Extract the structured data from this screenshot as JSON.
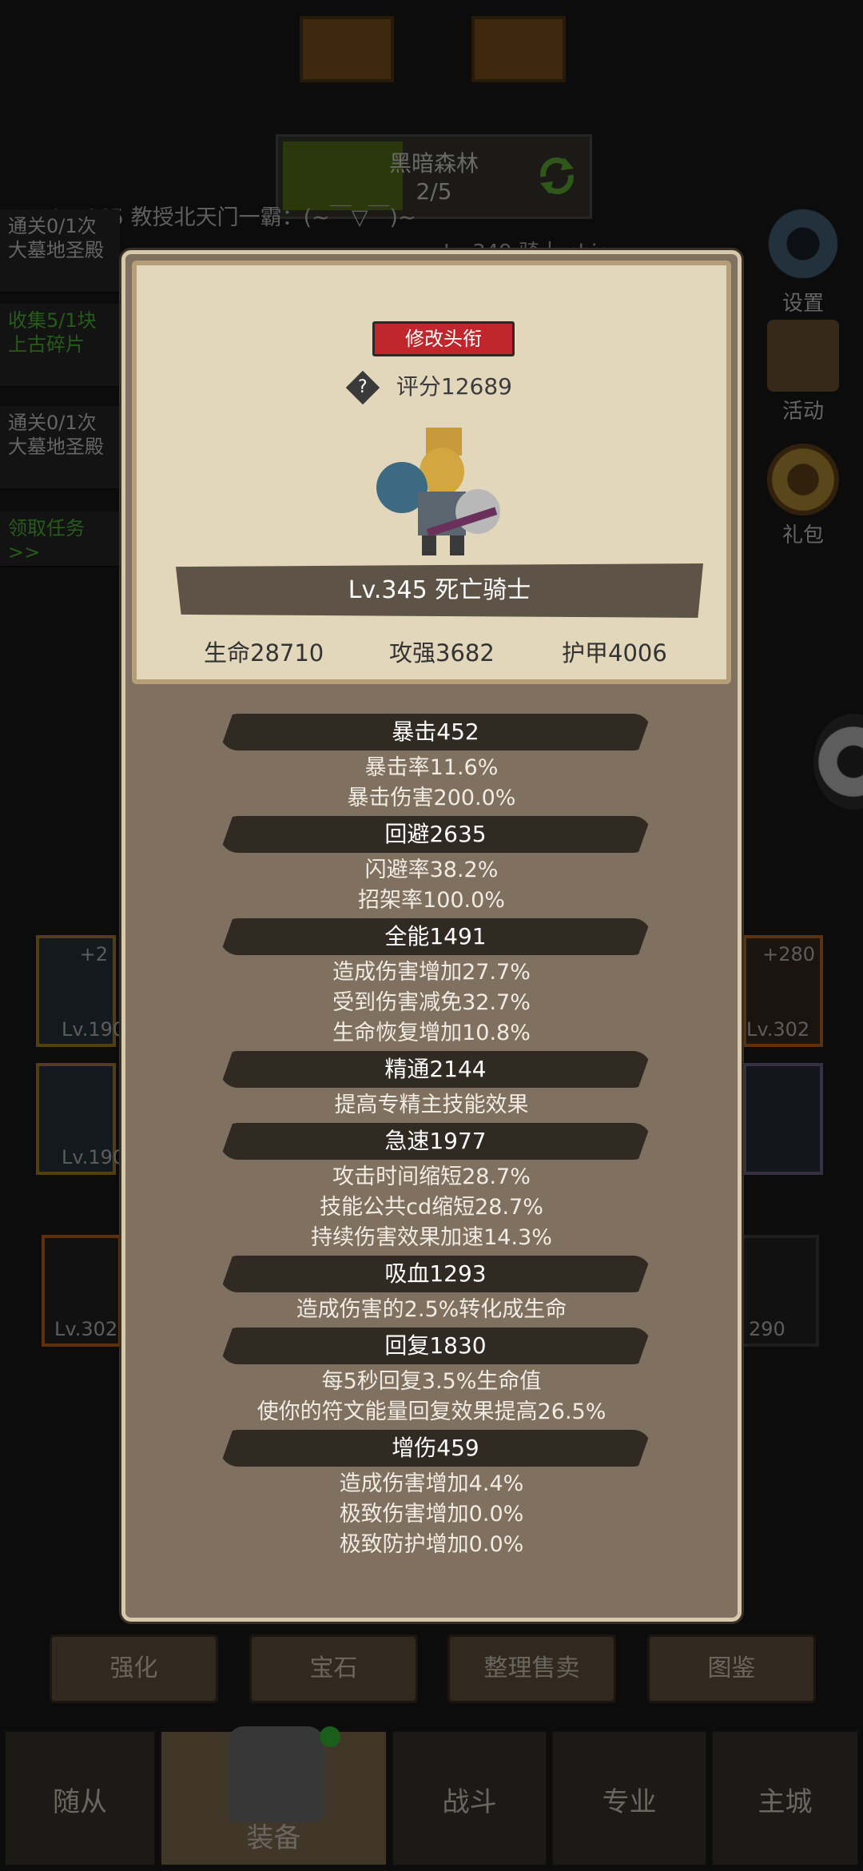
{
  "background": {
    "map": {
      "name": "黑暗森林",
      "progress": "2/5"
    },
    "player_line": "Lv.445 教授北天门一霸：(~￣▽￣)~",
    "other_player": "Lv.349 骑士 chic",
    "quests": [
      {
        "text": "通关0/1次大墓地圣殿",
        "color": "#dddddd"
      },
      {
        "text": "收集5/1块上古碎片",
        "color": "#55c93a"
      },
      {
        "text": "通关0/1次大墓地圣殿",
        "color": "#dddddd"
      },
      {
        "text": "领取任务>>",
        "color": "#55c93a"
      }
    ],
    "side_buttons": [
      {
        "label": "设置",
        "icon": "gear-icon"
      },
      {
        "label": "活动",
        "icon": "calendar-icon"
      },
      {
        "label": "礼包",
        "icon": "gift-bag-icon"
      }
    ],
    "equip_labels": [
      "+2",
      "Lv.190",
      "Lv.190",
      "Lv.302",
      "+280",
      "Lv.302",
      "290"
    ],
    "bottom_buttons": [
      "强化",
      "宝石",
      "整理售卖",
      "图鉴"
    ],
    "nav_tabs": [
      "随从",
      "装备",
      "战斗",
      "专业",
      "主城"
    ]
  },
  "modal": {
    "title_button": "修改头衔",
    "score": "评分12689",
    "hero_name": "Lv.345 死亡骑士",
    "base_stats": [
      "生命28710",
      "攻强3682",
      "护甲4006"
    ],
    "categories": [
      {
        "title": "暴击452",
        "lines": [
          "暴击率11.6%",
          "暴击伤害200.0%"
        ]
      },
      {
        "title": "回避2635",
        "lines": [
          "闪避率38.2%",
          "招架率100.0%"
        ]
      },
      {
        "title": "全能1491",
        "lines": [
          "造成伤害增加27.7%",
          "受到伤害减免32.7%",
          "生命恢复增加10.8%"
        ]
      },
      {
        "title": "精通2144",
        "lines": [
          "提高专精主技能效果"
        ]
      },
      {
        "title": "急速1977",
        "lines": [
          "攻击时间缩短28.7%",
          "技能公共cd缩短28.7%",
          "持续伤害效果加速14.3%"
        ]
      },
      {
        "title": "吸血1293",
        "lines": [
          "造成伤害的2.5%转化成生命"
        ]
      },
      {
        "title": "回复1830",
        "lines": [
          "每5秒回复3.5%生命值",
          "使你的符文能量回复效果提高26.5%"
        ]
      },
      {
        "title": "增伤459",
        "lines": [
          "造成伤害增加4.4%",
          "极致伤害增加0.0%",
          "极致防护增加0.0%"
        ]
      }
    ]
  }
}
